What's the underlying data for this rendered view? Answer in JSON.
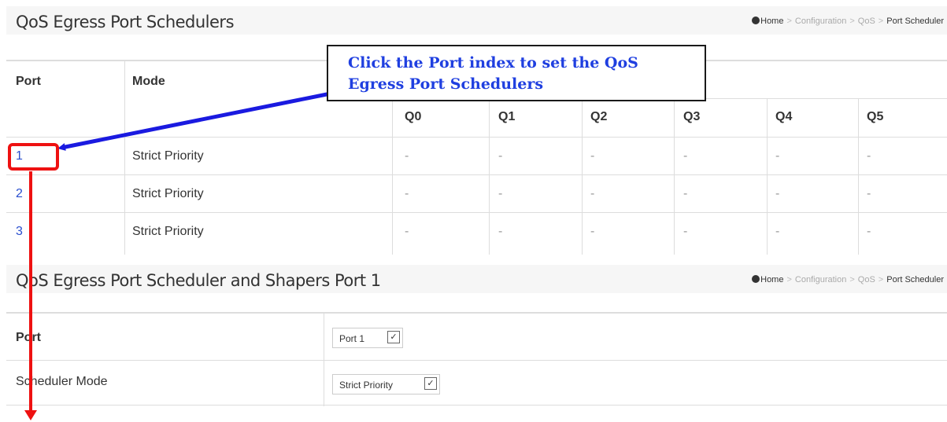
{
  "panel1": {
    "title": "QoS Egress Port Schedulers",
    "breadcrumb": {
      "home": "Home",
      "items": [
        "Configuration",
        "QoS",
        "Port Scheduler"
      ]
    },
    "headers": {
      "port": "Port",
      "mode": "Mode",
      "queues": [
        "Q0",
        "Q1",
        "Q2",
        "Q3",
        "Q4",
        "Q5"
      ]
    },
    "rows": [
      {
        "port": "1",
        "mode": "Strict Priority",
        "q": [
          "-",
          "-",
          "-",
          "-",
          "-",
          "-"
        ]
      },
      {
        "port": "2",
        "mode": "Strict Priority",
        "q": [
          "-",
          "-",
          "-",
          "-",
          "-",
          "-"
        ]
      },
      {
        "port": "3",
        "mode": "Strict Priority",
        "q": [
          "-",
          "-",
          "-",
          "-",
          "-",
          "-"
        ]
      }
    ]
  },
  "panel2": {
    "title": "QoS Egress Port Scheduler and Shapers  Port 1",
    "breadcrumb": {
      "home": "Home",
      "items": [
        "Configuration",
        "QoS",
        "Port Scheduler"
      ]
    },
    "port_label": "Port",
    "port_value": "Port 1",
    "mode_label": "Scheduler Mode",
    "mode_value": "Strict Priority"
  },
  "callout": {
    "line1": "Click the Port index to set the QoS",
    "line2": "Egress Port Schedulers"
  },
  "colors": {
    "link": "#2a4fcf",
    "callout_text": "#1f3fe0",
    "arrow_blue": "#1a1ae0",
    "arrow_red": "#ee1111"
  },
  "icons": {
    "home": "home-icon",
    "dropdown": "chevron-down-icon"
  }
}
